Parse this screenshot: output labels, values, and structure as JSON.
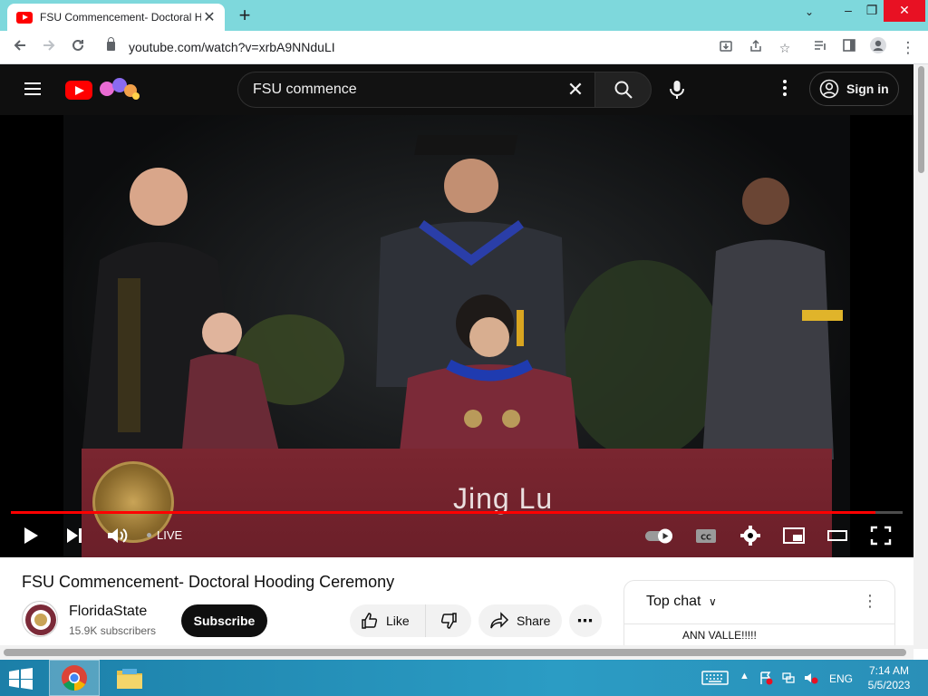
{
  "browser": {
    "tab_title": "FSU Commencement- Doctoral H",
    "url": "youtube.com/watch?v=xrbA9NNduLI",
    "window_controls": [
      "–",
      "❐",
      "✕"
    ]
  },
  "youtube": {
    "search_query": "FSU commence",
    "signin_label": "Sign in"
  },
  "player": {
    "lower_third_name": "Jing Lu",
    "live_label": "LIVE",
    "progress_fraction": 0.97
  },
  "video": {
    "title": "FSU Commencement- Doctoral Hooding Ceremony",
    "channel": "FloridaState",
    "subscribers": "15.9K subscribers",
    "subscribe_label": "Subscribe",
    "like_label": "Like",
    "share_label": "Share"
  },
  "chat": {
    "title": "Top chat",
    "message": "ANN VALLE!!!!!"
  },
  "taskbar": {
    "language": "ENG",
    "time": "7:14 AM",
    "date": "5/5/2023"
  },
  "colors": {
    "youtube_red": "#ff0000",
    "banner_maroon": "#782530",
    "chrome_tabbar": "#7ed8dc"
  },
  "icons": [
    "youtube-favicon",
    "close-icon",
    "plus-icon",
    "back-icon",
    "forward-icon",
    "reload-icon",
    "lock-icon",
    "install-icon",
    "share-icon",
    "star-icon",
    "reading-list-icon",
    "side-panel-icon",
    "profile-icon",
    "menu-dots-icon",
    "hamburger-icon",
    "youtube-logo",
    "search-icon",
    "microphone-icon",
    "user-circle-icon",
    "play-icon",
    "next-icon",
    "volume-icon",
    "autoplay-toggle-icon",
    "captions-icon",
    "settings-icon",
    "miniplayer-icon",
    "theater-icon",
    "fullscreen-icon",
    "thumbs-up-icon",
    "thumbs-down-icon",
    "share-arrow-icon",
    "more-horiz-icon",
    "chevron-down-icon",
    "windows-start-icon",
    "chrome-icon",
    "file-explorer-icon",
    "keyboard-icon",
    "flag-icon",
    "network-icon",
    "volume-mute-icon"
  ]
}
